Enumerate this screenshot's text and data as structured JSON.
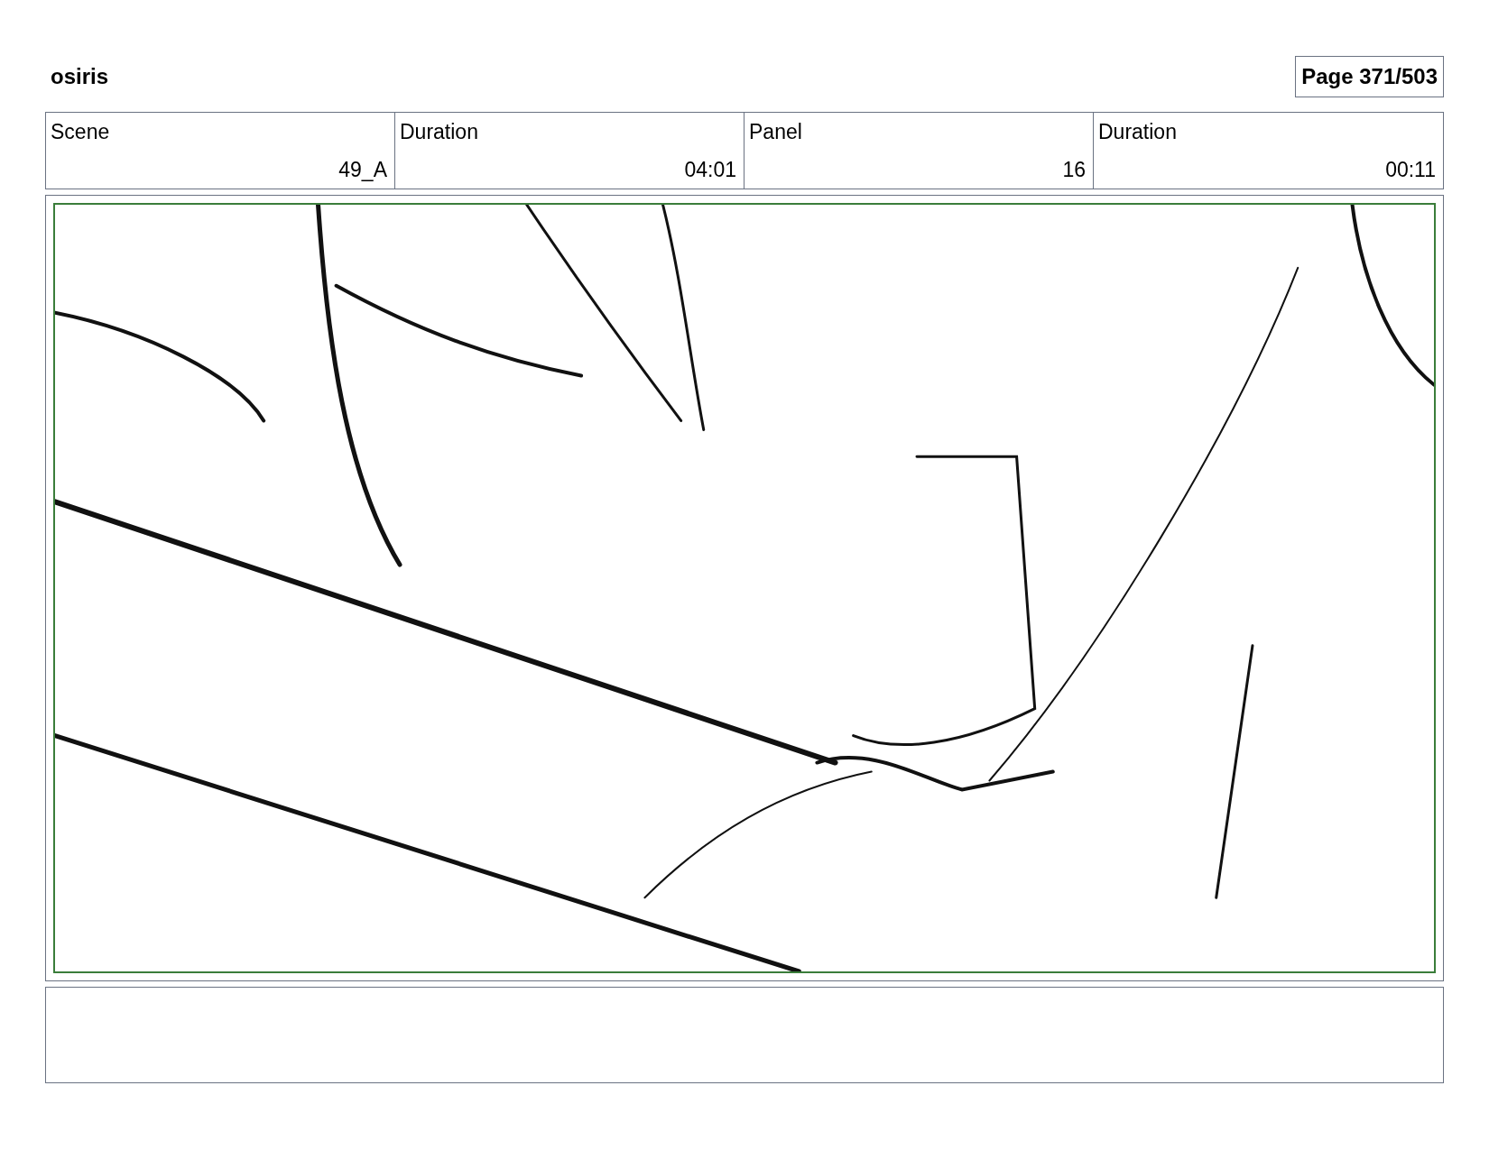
{
  "project": {
    "title": "osiris"
  },
  "page": {
    "label": "Page 371/503"
  },
  "header_table": {
    "columns": [
      "Scene",
      "Duration",
      "Panel",
      "Duration"
    ],
    "row": [
      "49_A",
      "04:01",
      "16",
      "00:11"
    ]
  },
  "panel": {
    "kind": "sketch"
  }
}
